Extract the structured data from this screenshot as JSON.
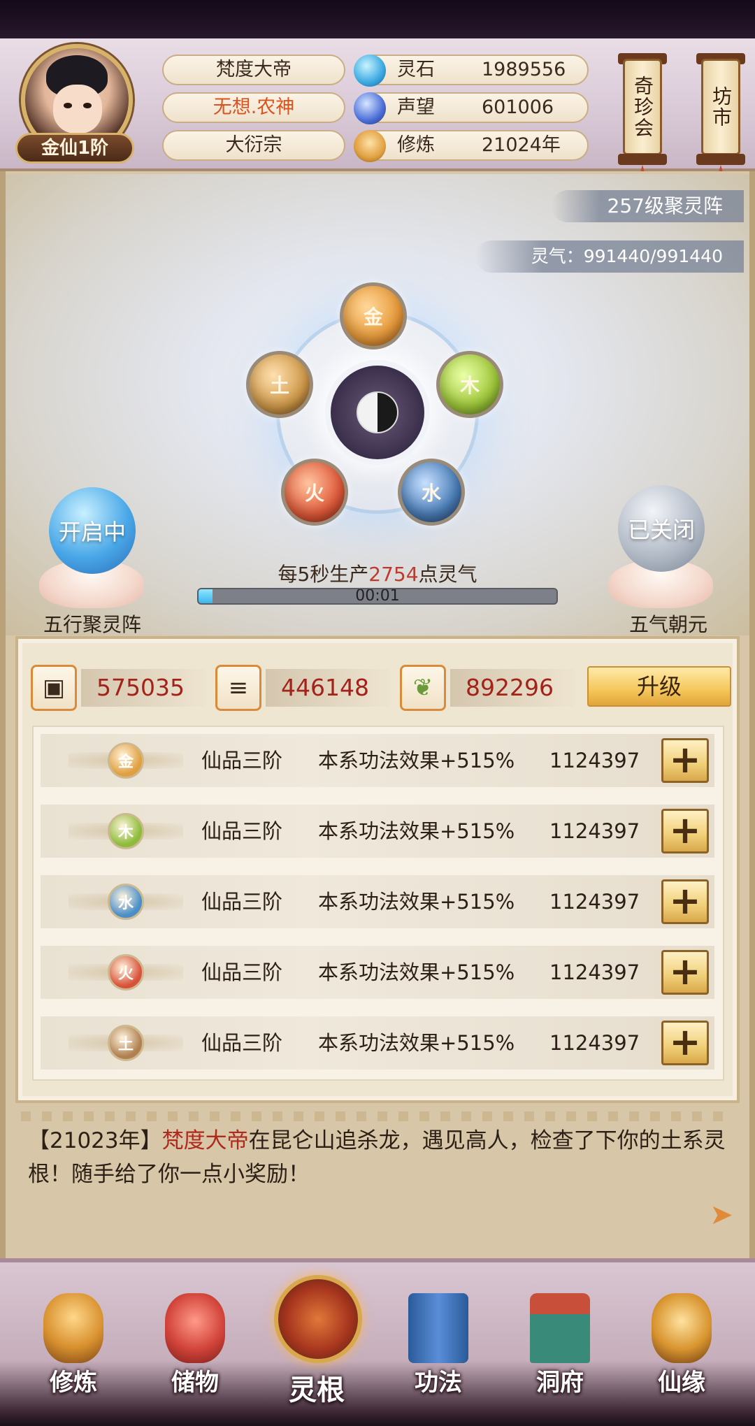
{
  "player": {
    "rank": "金仙1阶",
    "name": "梵度大帝",
    "title": "无想.农神",
    "sect": "大衍宗"
  },
  "resources": [
    {
      "icon": "spirit-stone-icon",
      "label": "灵石",
      "value": "1989556"
    },
    {
      "icon": "reputation-icon",
      "label": "声望",
      "value": "601006"
    },
    {
      "icon": "cultivation-icon",
      "label": "修炼",
      "value": "21024年"
    }
  ],
  "shops": {
    "treasure": "奇珍会",
    "market": "坊市"
  },
  "formation": {
    "level_label": "257级聚灵阵",
    "qi_label": "灵气：991440/991440",
    "elements": [
      "金",
      "木",
      "水",
      "火",
      "土"
    ],
    "left_toggle": {
      "status": "开启中",
      "label": "五行聚灵阵"
    },
    "right_toggle": {
      "status": "已关闭",
      "label": "五气朝元"
    },
    "produce_prefix": "每5秒生产",
    "produce_amount": "2754",
    "produce_suffix": "点灵气",
    "progress_time": "00:01",
    "progress_fraction": 0.04
  },
  "materials": [
    {
      "icon": "ore-icon",
      "value": "575035"
    },
    {
      "icon": "wood-icon",
      "value": "446148"
    },
    {
      "icon": "herb-icon",
      "value": "892296"
    }
  ],
  "upgrade_label": "升级",
  "elements_list": [
    {
      "element": "金",
      "grade": "仙品三阶",
      "effect": "本系功法效果+515%",
      "value": "1124397",
      "color": "#e0a040"
    },
    {
      "element": "木",
      "grade": "仙品三阶",
      "effect": "本系功法效果+515%",
      "value": "1124397",
      "color": "#8dbb3a"
    },
    {
      "element": "水",
      "grade": "仙品三阶",
      "effect": "本系功法效果+515%",
      "value": "1124397",
      "color": "#4a8ec8"
    },
    {
      "element": "火",
      "grade": "仙品三阶",
      "effect": "本系功法效果+515%",
      "value": "1124397",
      "color": "#d8523a"
    },
    {
      "element": "土",
      "grade": "仙品三阶",
      "effect": "本系功法效果+515%",
      "value": "1124397",
      "color": "#b08050"
    }
  ],
  "log": {
    "year": "【21023年】",
    "name": "梵度大帝",
    "text": "在昆仑山追杀龙，遇见高人，检查了下你的土系灵根！随手给了你一点小奖励！"
  },
  "nav": [
    {
      "label": "修炼",
      "icon": "cultivate-icon"
    },
    {
      "label": "储物",
      "icon": "storage-bag-icon"
    },
    {
      "label": "灵根",
      "icon": "spirit-root-icon"
    },
    {
      "label": "功法",
      "icon": "technique-book-icon"
    },
    {
      "label": "洞府",
      "icon": "cave-abode-icon"
    },
    {
      "label": "仙缘",
      "icon": "immortal-fate-icon"
    }
  ]
}
